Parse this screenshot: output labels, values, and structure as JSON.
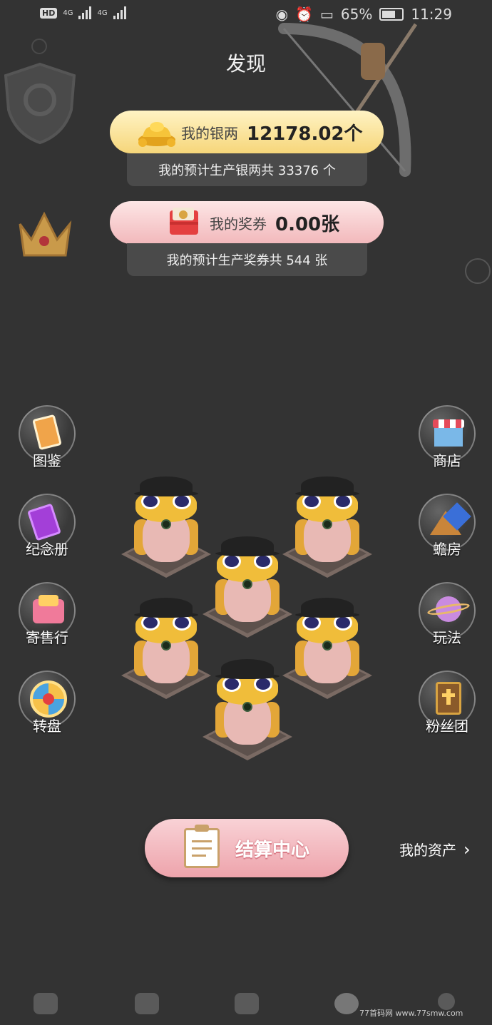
{
  "status_bar": {
    "network_chip": "HD",
    "sim1": "4G",
    "sim2": "4G",
    "battery": "65%",
    "time": "11:29"
  },
  "page": {
    "title": "发现"
  },
  "silver": {
    "label": "我的银两",
    "value": "12178.02个",
    "estimate": "我的预计生产银两共 33376 个"
  },
  "ticket": {
    "label": "我的奖券",
    "value": "0.00张",
    "estimate": "我的预计生产奖券共 544 张"
  },
  "left_menu": [
    {
      "label": "图鉴",
      "icon": "card-book-icon"
    },
    {
      "label": "纪念册",
      "icon": "album-icon"
    },
    {
      "label": "寄售行",
      "icon": "gift-basket-icon"
    },
    {
      "label": "转盘",
      "icon": "lucky-wheel-icon"
    }
  ],
  "right_menu": [
    {
      "label": "商店",
      "icon": "shop-icon"
    },
    {
      "label": "蟾房",
      "icon": "tent-icon"
    },
    {
      "label": "玩法",
      "icon": "planet-icon"
    },
    {
      "label": "粉丝团",
      "icon": "book-icon"
    }
  ],
  "settle_button": {
    "label": "结算中心"
  },
  "my_assets": {
    "label": "我的资产"
  },
  "watermark": "77首码网 www.77smw.com",
  "colors": {
    "background": "#333333",
    "silver_pill": "#f6d67a",
    "ticket_pill": "#f2b8bb",
    "settle_button": "#eda3ab"
  }
}
